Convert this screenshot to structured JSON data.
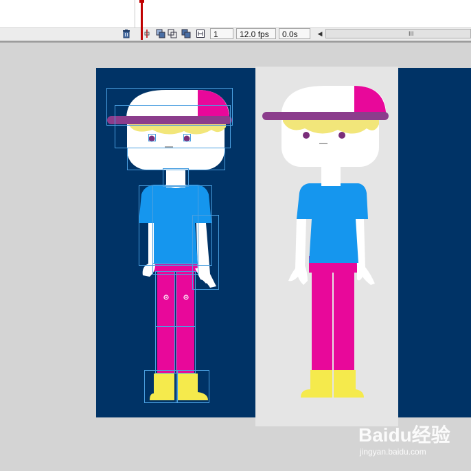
{
  "app": {
    "colors": {
      "stage_bg": "#d4d4d4",
      "navy": "#003366",
      "panel_grey": "#e5e5e5",
      "shirt": "#1596ee",
      "pants": "#e8089a",
      "boots": "#f5ea4c",
      "cap_accent": "#e8089a",
      "cap_brim": "#8b3d8c",
      "hair": "#f2e67a",
      "skin": "#ffffff",
      "eyes": "#7a2e7a",
      "selection": "#4a9fe0"
    }
  },
  "timeline": {
    "current_frame": "1",
    "frame_rate": "12.0 fps",
    "elapsed_time": "0.0s",
    "scroll_grip": "III",
    "scroll_left_arrow": "◀",
    "icons": {
      "trash": "trash-icon",
      "center_frame": "center-frame-icon",
      "onion_skin": "onion-skin-icon",
      "onion_skin_outlines": "onion-skin-outlines-icon",
      "edit_multiple_frames": "edit-multiple-frames-icon",
      "modify_onion_markers": "modify-onion-markers-icon"
    }
  },
  "watermark": {
    "logo": "Baidu经验",
    "url": "jingyan.baidu.com"
  }
}
